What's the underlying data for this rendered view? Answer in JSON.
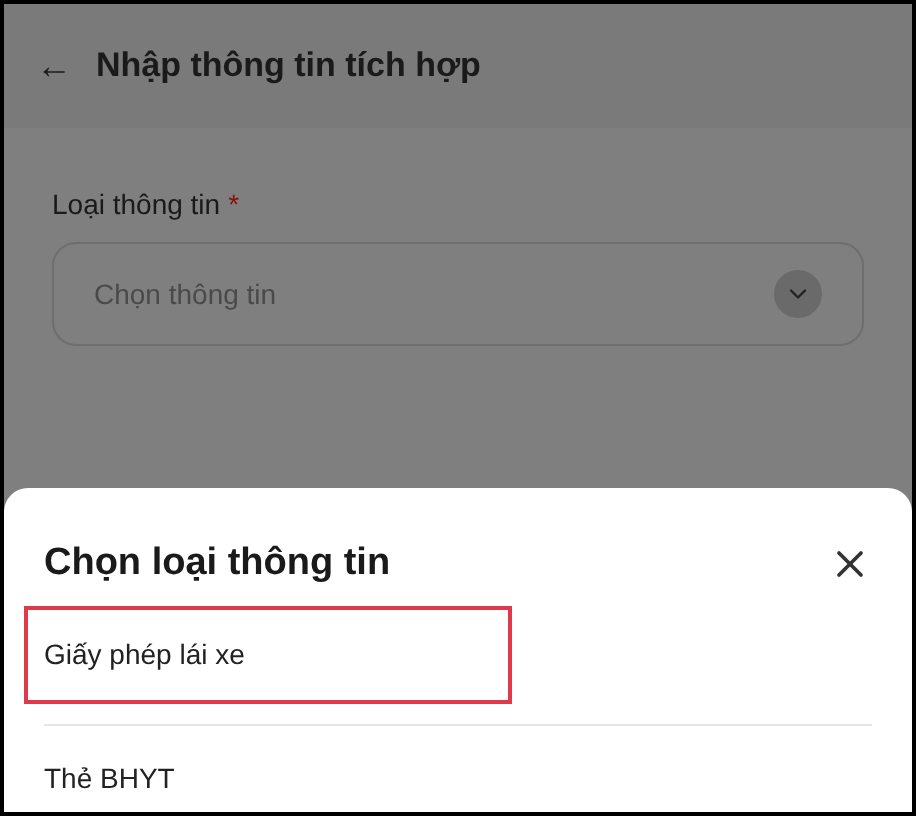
{
  "header": {
    "back_icon": "←",
    "title": "Nhập thông tin tích hợp"
  },
  "form": {
    "label": "Loại thông tin",
    "required_mark": "*",
    "select": {
      "placeholder": "Chọn thông tin"
    }
  },
  "sheet": {
    "title": "Chọn loại thông tin",
    "options": [
      {
        "label": "Giấy phép lái xe",
        "highlighted": true
      },
      {
        "label": "Thẻ BHYT",
        "highlighted": false
      }
    ]
  }
}
